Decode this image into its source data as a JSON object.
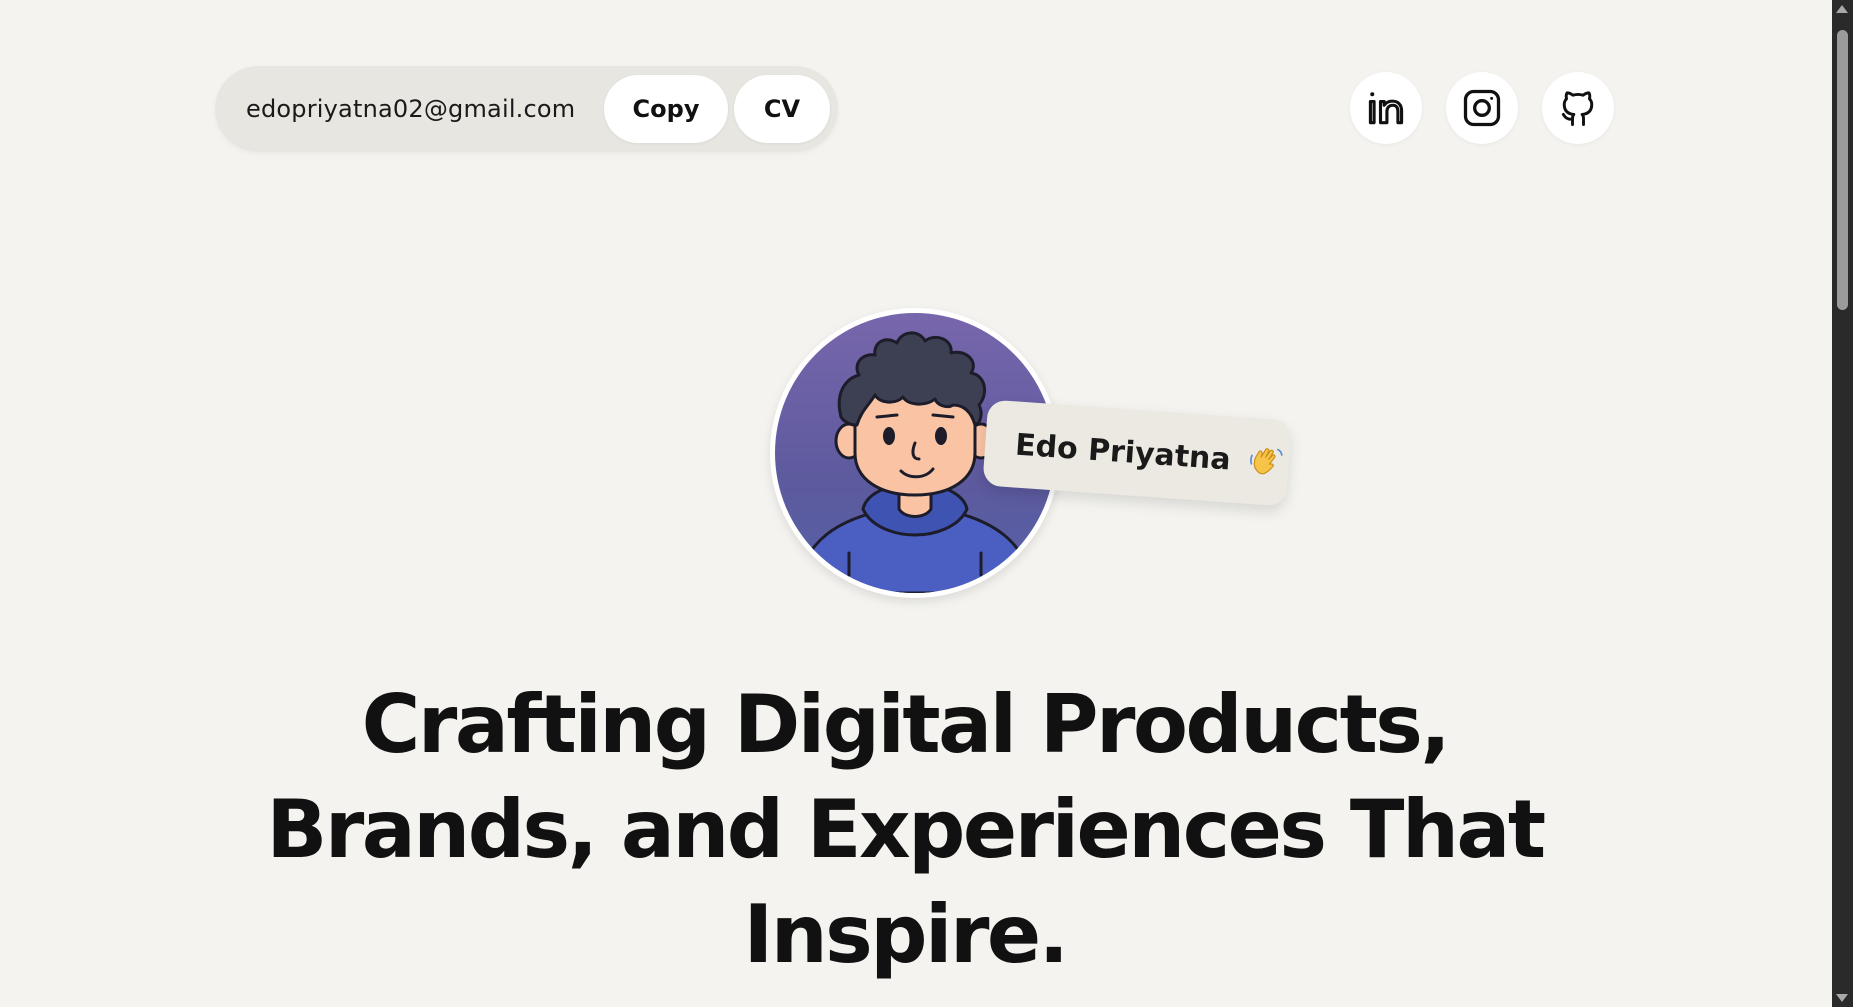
{
  "header": {
    "email": "edopriyatna02@gmail.com",
    "copy_label": "Copy",
    "cv_label": "CV"
  },
  "social": [
    {
      "name": "LinkedIn",
      "icon": "linkedin-icon"
    },
    {
      "name": "Instagram",
      "icon": "instagram-icon"
    },
    {
      "name": "GitHub",
      "icon": "github-icon"
    }
  ],
  "profile": {
    "name": "Edo Priyatna",
    "emoji": "waving-hand-icon"
  },
  "hero": {
    "headline": "Crafting Digital Products, Brands, and Experiences That Inspire."
  },
  "colors": {
    "background": "#f4f3ef",
    "pill_background": "#e8e6e1",
    "button_background": "#ffffff",
    "text": "#111111",
    "avatar_gradient_top": "#7866ac",
    "avatar_gradient_bottom": "#5560a8",
    "hoodie": "#4a5fc1",
    "skin": "#f9c3a4",
    "hair": "#3d3f52"
  }
}
